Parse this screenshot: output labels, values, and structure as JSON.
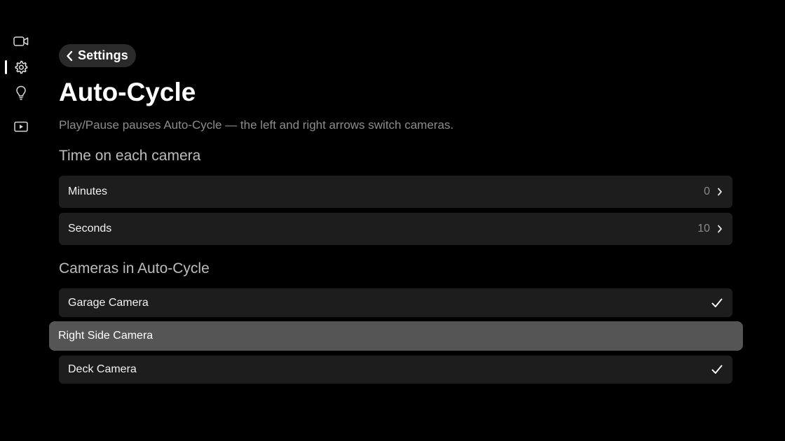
{
  "sidebar": {
    "items": [
      {
        "icon": "video-camera-icon"
      },
      {
        "icon": "gear-icon",
        "active": true
      },
      {
        "icon": "lightbulb-icon"
      },
      {
        "icon": "play-box-icon"
      }
    ]
  },
  "header": {
    "back_label": "Settings",
    "title": "Auto-Cycle",
    "subtitle": "Play/Pause pauses Auto-Cycle — the left and right arrows switch cameras."
  },
  "time_section": {
    "title": "Time on each camera",
    "rows": [
      {
        "label": "Minutes",
        "value": "0"
      },
      {
        "label": "Seconds",
        "value": "10"
      }
    ]
  },
  "cameras_section": {
    "title": "Cameras in Auto-Cycle",
    "cameras": [
      {
        "label": "Garage Camera",
        "checked": true
      },
      {
        "label": "Right Side Camera",
        "checked": false,
        "focused": true
      },
      {
        "label": "Deck Camera",
        "checked": true
      }
    ]
  },
  "colors": {
    "background": "#000000",
    "row": "#1d1d1d",
    "focused_row": "#555555",
    "secondary_text": "#8c8c8c"
  }
}
